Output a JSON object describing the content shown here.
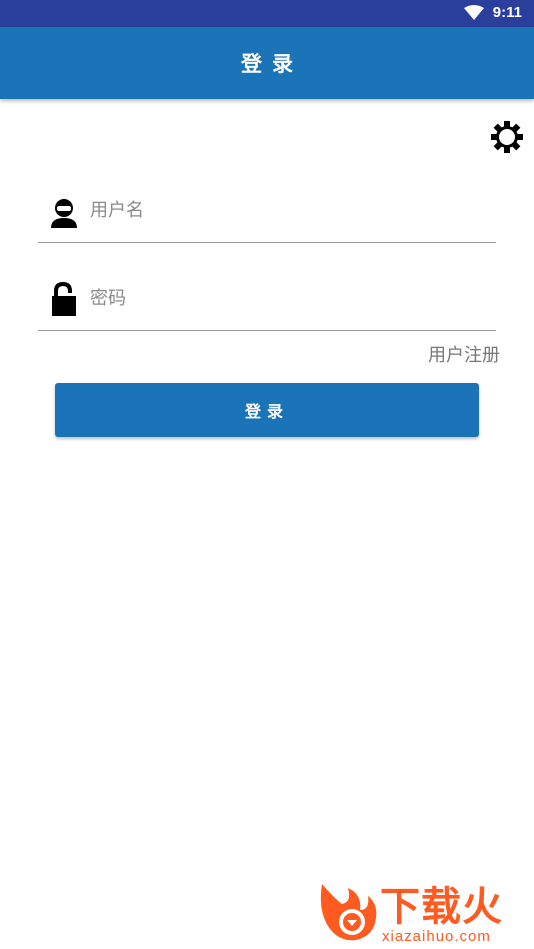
{
  "status_bar": {
    "time": "9:11",
    "wifi_icon": "wifi-icon"
  },
  "app_bar": {
    "title": "登录"
  },
  "settings": {
    "icon": "gear-icon"
  },
  "username": {
    "placeholder": "用户名",
    "value": "",
    "icon": "user-icon"
  },
  "password": {
    "placeholder": "密码",
    "value": "",
    "icon": "lock-icon"
  },
  "register_link": "用户注册",
  "login_button": "登录",
  "watermark": {
    "brand": "下载火",
    "url": "xiazaihuo.com"
  },
  "colors": {
    "primary": "#1b74b8",
    "status_bar": "#2a3f9c",
    "watermark": "#ff5a1f"
  }
}
